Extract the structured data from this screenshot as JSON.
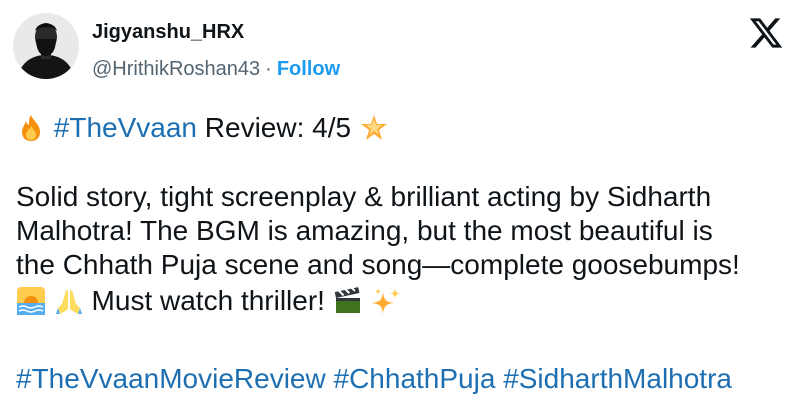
{
  "author": {
    "name": "Jigyanshu_HRX",
    "handle": "@HrithikRoshan43",
    "separator": "·",
    "follow_label": "Follow"
  },
  "platform_icon": "x-logo-icon",
  "post": {
    "line1": {
      "hashtag": "#TheVvaan",
      "text": " Review: 4/5 ",
      "emoji_before": "fire-icon",
      "emoji_after": "star-icon"
    },
    "body_lines": [
      "Solid story, tight screenplay & brilliant acting by Sidharth",
      "Malhotra! The BGM is amazing, but the most beautiful is",
      "the Chhath Puja scene and song—complete goosebumps!"
    ],
    "last_line": {
      "emoji_before": [
        "sunrise-over-water-icon",
        "folded-hands-icon"
      ],
      "text": " Must watch thriller! ",
      "emoji_after": [
        "clapper-board-icon",
        "sparkles-icon"
      ]
    },
    "hashtags": [
      "#TheVvaanMovieReview",
      "#ChhathPuja",
      "#SidharthMalhotra"
    ]
  },
  "colors": {
    "hashtag": "#1d6fb2",
    "follow": "#1d9bf0",
    "secondary_text": "#536471",
    "primary_text": "#0f1419"
  }
}
